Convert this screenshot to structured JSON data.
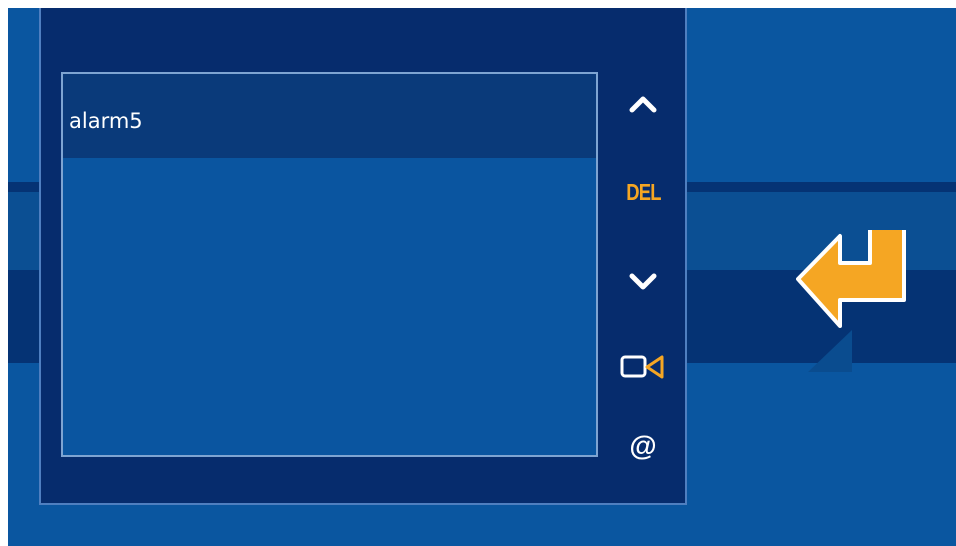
{
  "colors": {
    "background": "#0a56a0",
    "panel": "#062c6d",
    "list_background": "#0a55a0",
    "selected_item": "#0a3a7a",
    "accent": "#f5a623",
    "text": "#ffffff"
  },
  "list": {
    "items": [
      "alarm5"
    ]
  },
  "sidebar": {
    "up_icon": "chevron-up-icon",
    "delete_label": "DEL",
    "down_icon": "chevron-down-icon",
    "video_icon": "video-camera-icon",
    "email_label": "@"
  },
  "enter_icon": "enter-arrow-icon"
}
